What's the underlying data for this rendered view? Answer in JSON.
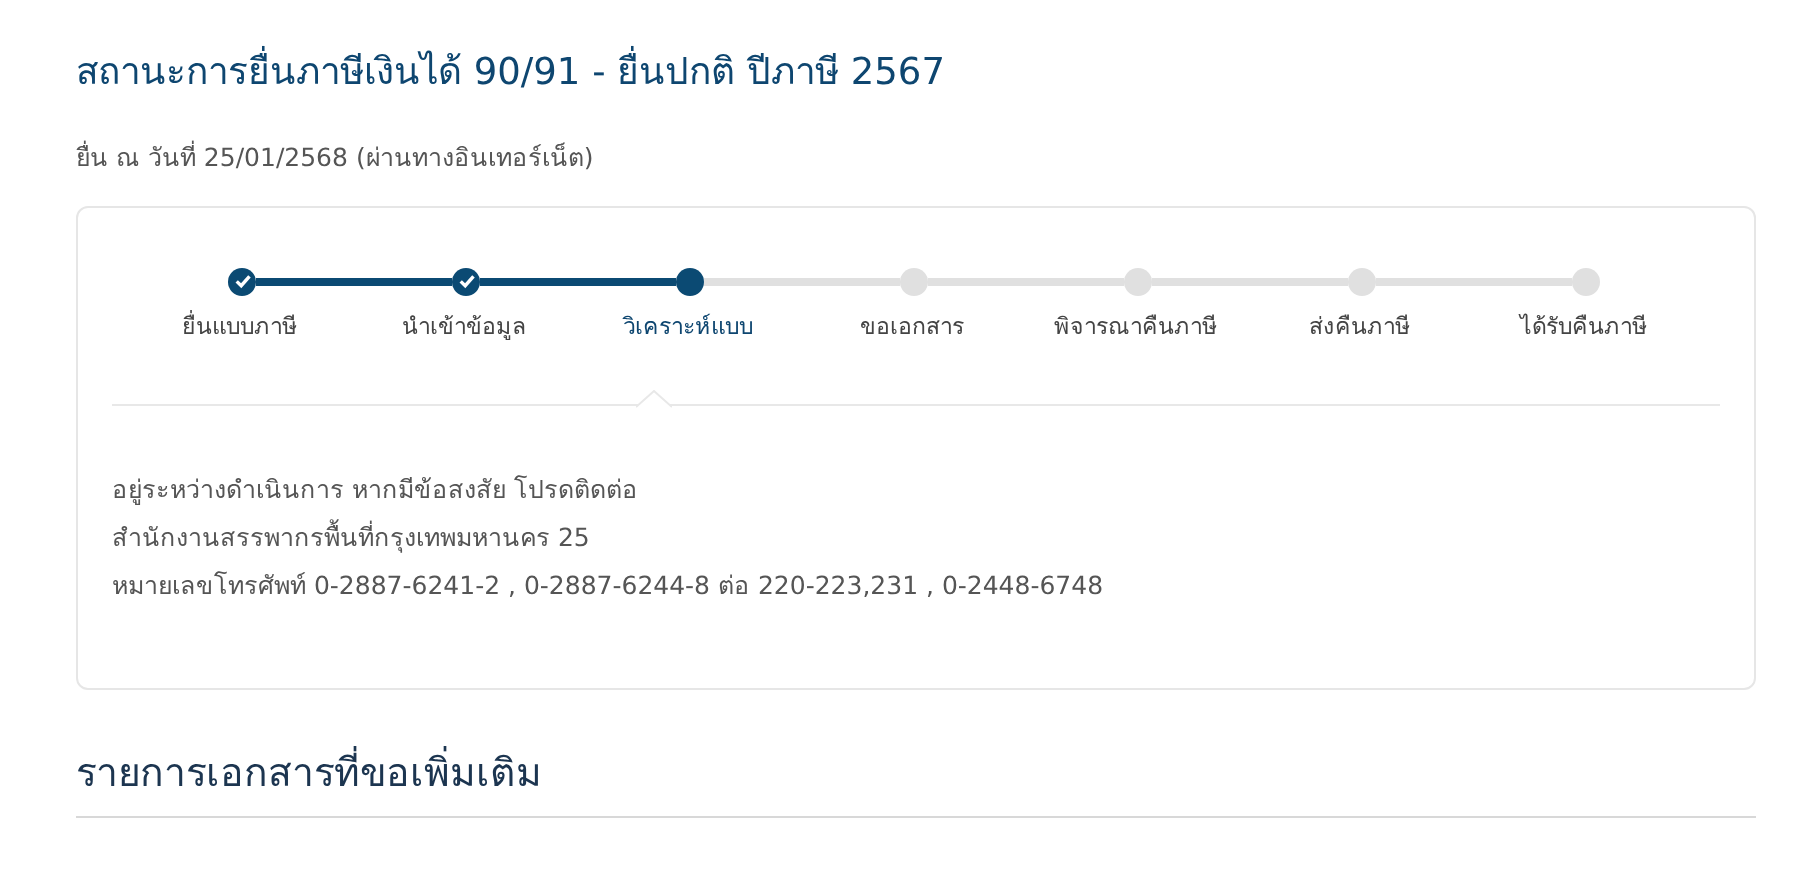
{
  "title": "สถานะการยื่นภาษีเงินได้ 90/91 - ยื่นปกติ ปีภาษี 2567",
  "subtitle": "ยื่น ณ วันที่ 25/01/2568 (ผ่านทางอินเทอร์เน็ต)",
  "steps": [
    {
      "label": "ยื่นแบบภาษี",
      "completed": true,
      "selected": false
    },
    {
      "label": "นำเข้าข้อมูล",
      "completed": true,
      "selected": false
    },
    {
      "label": "วิเคราะห์แบบ",
      "completed": false,
      "selected": true
    },
    {
      "label": "ขอเอกสาร",
      "completed": false,
      "selected": false
    },
    {
      "label": "พิจารณาคืนภาษี",
      "completed": false,
      "selected": false
    },
    {
      "label": "ส่งคืนภาษี",
      "completed": false,
      "selected": false
    },
    {
      "label": "ได้รับคืนภาษี",
      "completed": false,
      "selected": false
    }
  ],
  "message_lines": [
    "อยู่ระหว่างดำเนินการ หากมีข้อสงสัย โปรดติดต่อ",
    "สำนักงานสรรพากรพื้นที่กรุงเทพมหานคร 25",
    "หมายเลขโทรศัพท์ 0-2887-6241-2 , 0-2887-6244-8 ต่อ 220-223,231 , 0-2448-6748"
  ],
  "section_heading": "รายการเอกสารที่ขอเพิ่มเติม"
}
